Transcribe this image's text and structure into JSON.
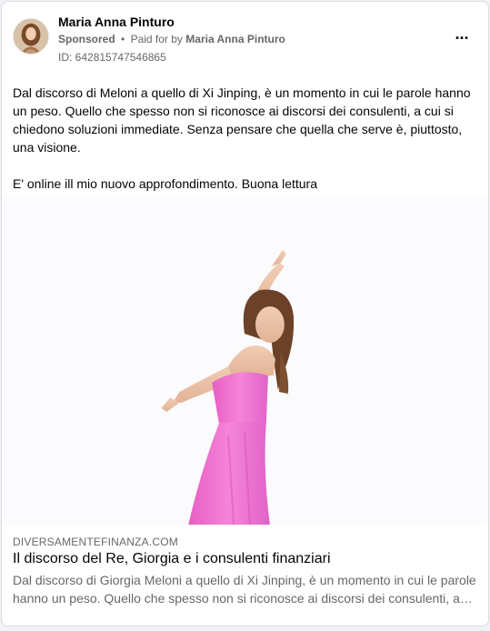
{
  "post": {
    "author": "Maria Anna Pinturo",
    "sponsored_label": "Sponsored",
    "separator": "•",
    "paid_for_by_label": "Paid for by",
    "paid_for_by_name": "Maria Anna Pinturo",
    "ad_id": "ID: 642815747546865",
    "more_icon": "more-horizontal-icon",
    "more_glyph": "···",
    "text_paragraph_1": "Dal discorso di Meloni a quello di Xi Jinping, è un momento in cui le parole hanno un peso. Quello che spesso non si riconosce ai discorsi dei consulenti, a cui si chiedono soluzioni immediate. Senza pensare che quella che serve è, piuttosto, una visione.",
    "text_paragraph_2": "E' online ill mio nuovo approfondimento. Buona lettura"
  },
  "link_preview": {
    "domain": "DIVERSAMENTEFINANZA.COM",
    "title": "Il discorso del Re, Giorgia e i consulenti finanziari",
    "description": "Dal discorso di Giorgia Meloni a quello di Xi Jinping, è un momento in cui le parole hanno un peso. Quello che spesso non si riconosce ai discorsi dei consulenti, a cui si chiedono soluzioni immediate."
  },
  "colors": {
    "card_background": "#ffffff",
    "page_background": "#f0f2f5",
    "primary_text": "#050505",
    "secondary_text": "#65676b",
    "dress_pink": "#f06fcf"
  }
}
